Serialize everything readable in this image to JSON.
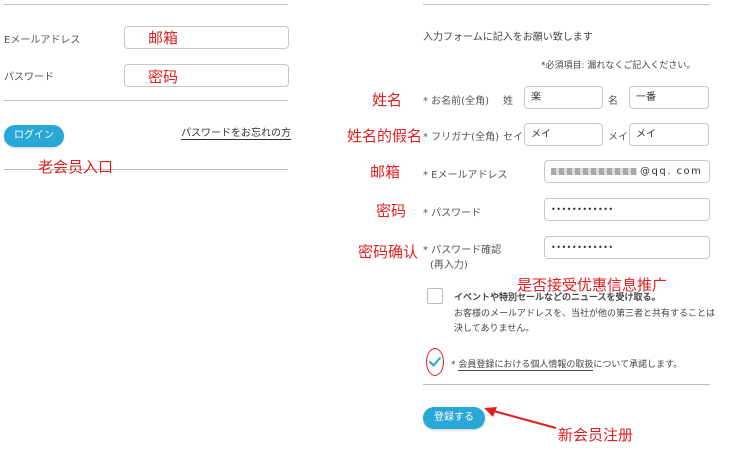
{
  "login": {
    "email_label": "Eメールアドレス",
    "email_value": "邮箱",
    "password_label": "パスワード",
    "password_value": "密码",
    "login_button": "ログイン",
    "forgot_link": "パスワードをお忘れの方",
    "annotation": "老会员入口"
  },
  "register": {
    "intro": "入力フォームに記入をお願い致します",
    "required_note": "*必須項目: 漏れなくご記入ください。",
    "name": {
      "label": "* お名前(全角)",
      "last_label": "姓",
      "last_value": "楽",
      "first_label": "名",
      "first_value": "一番",
      "annotation": "姓名"
    },
    "kana": {
      "label": "* フリガナ(全角)",
      "last_label": "セイ",
      "last_value": "メイ",
      "first_label": "メイ",
      "first_value": "メイ",
      "annotation": "姓名的假名"
    },
    "email": {
      "label": "* Eメールアドレス",
      "value": "@qq. com",
      "annotation": "邮箱"
    },
    "password": {
      "label": "* パスワード",
      "value": "••••••••••••",
      "annotation": "密码"
    },
    "password_confirm": {
      "label": "* パスワード確認",
      "sublabel": "(再入力)",
      "value": "••••••••••••",
      "annotation": "密码确认"
    },
    "newsletter": {
      "label": "イベントや特別セールなどのニュースを受け取る。",
      "desc_line1": "お客様のメールアドレスを、当社が他の第三者と共有することは",
      "desc_line2": "決してありません。",
      "checked": false,
      "annotation": "是否接受优惠信息推广"
    },
    "terms": {
      "prefix": "* ",
      "link": "会員登録における個人情報の取扱",
      "suffix": "について承諾します。",
      "checked": true
    },
    "submit_button": "登録する",
    "submit_annotation": "新会员注册"
  },
  "colors": {
    "accent": "#29a7d6",
    "annotation": "#e02020"
  }
}
